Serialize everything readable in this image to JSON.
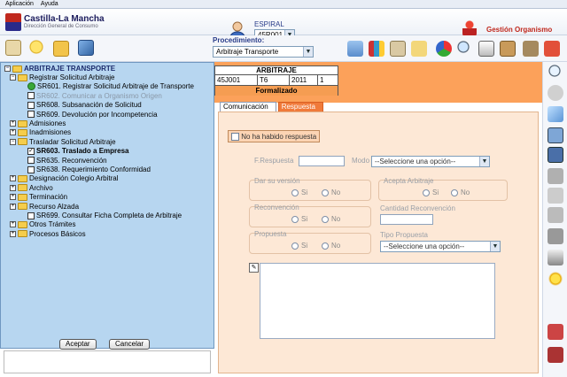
{
  "menu": [
    "Aplicación",
    "Ayuda"
  ],
  "brand": {
    "name": "Castilla-La Mancha",
    "subtitle": "Dirección General de Consumo"
  },
  "header": {
    "espiral_label": "ESPIRAL",
    "user_select": "45R001",
    "org_label": "Gestión Organismo",
    "procedimiento_label": "Procedimiento:",
    "procedimiento_value": "Arbitraje Transporte"
  },
  "record": {
    "title": "ARBITRAJE",
    "cells": [
      "45J001",
      "T6",
      "2011",
      "1"
    ],
    "status": "Formalizado"
  },
  "tabs": [
    {
      "label": "Comunicación",
      "active": true
    },
    {
      "label": "Respuesta",
      "active": false
    }
  ],
  "form": {
    "no_response": "No ha habido respuesta",
    "fecha_label": "F.Respuesta",
    "modo_label": "Modo",
    "modo_placeholder": "--Seleccione una opción--",
    "dar_version": "Dar su versión",
    "acepta": "Acepta Arbitraje",
    "reconvencion": "Reconvención",
    "cantidad": "Cantidad Reconvención",
    "propuesta": "Propuesta",
    "tipo_propuesta": "Tipo Propuesta",
    "tipo_placeholder": "--Seleccione una opción--",
    "si": "Si",
    "no": "No"
  },
  "tree": {
    "root": "ARBITRAJE TRANSPORTE",
    "items": [
      {
        "label": "Registrar Solicitud Arbitraje",
        "kind": "folder",
        "expand": "−"
      },
      {
        "label": "SR601. Registrar Solicitud Arbitraje de Transporte",
        "kind": "done"
      },
      {
        "label": "SR602. Comunicar a Organismo Origen",
        "kind": "disabled"
      },
      {
        "label": "SR608. Subsanación de Solicitud",
        "kind": "check"
      },
      {
        "label": "SR609. Devolución por Incompetencia",
        "kind": "check"
      },
      {
        "label": "Admisiones",
        "kind": "folder",
        "expand": "+"
      },
      {
        "label": "Inadmisiones",
        "kind": "folder",
        "expand": "+"
      },
      {
        "label": "Trasladar Solicitud Arbitraje",
        "kind": "folder",
        "expand": "−"
      },
      {
        "label": "SR603. Traslado a Empresa",
        "kind": "checked"
      },
      {
        "label": "SR635. Reconvención",
        "kind": "check"
      },
      {
        "label": "SR638. Requerimiento Conformidad",
        "kind": "check"
      },
      {
        "label": "Designación Colegio Arbitral",
        "kind": "folder",
        "expand": "+"
      },
      {
        "label": "Archivo",
        "kind": "folder",
        "expand": "+"
      },
      {
        "label": "Terminación",
        "kind": "folder",
        "expand": "+"
      },
      {
        "label": "Recurso Alzada",
        "kind": "folder",
        "expand": "+"
      },
      {
        "label": "SR699. Consultar Ficha Completa de Arbitraje",
        "kind": "check"
      },
      {
        "label": "Otros Trámites",
        "kind": "folder",
        "expand": "+"
      },
      {
        "label": "Procesos Básicos",
        "kind": "folder",
        "expand": "+"
      }
    ],
    "accept": "Aceptar",
    "cancel": "Cancelar"
  },
  "colors": {
    "orange": "#fca15a",
    "tree_bg": "#b7d6f0",
    "accent": "#2a3d8a"
  }
}
